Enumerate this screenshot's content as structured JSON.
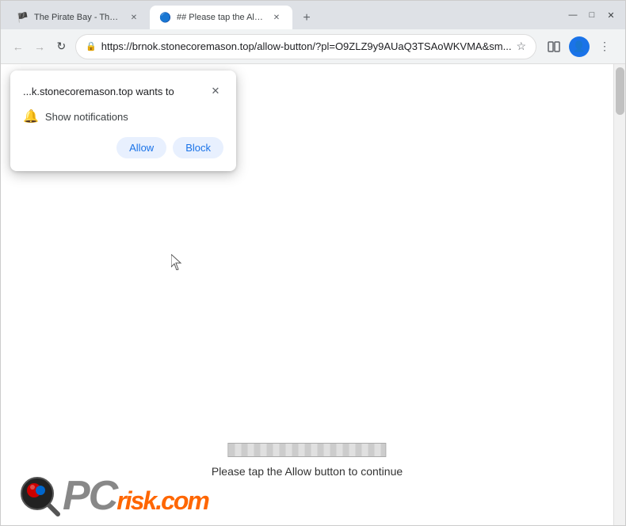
{
  "browser": {
    "tabs": [
      {
        "id": "tab1",
        "label": "The Pirate Bay - The galaxy's m...",
        "favicon": "🏴",
        "active": false
      },
      {
        "id": "tab2",
        "label": "## Please tap the Allow button...",
        "favicon": "🔵",
        "active": true
      }
    ],
    "window_controls": {
      "minimize": "—",
      "maximize": "□",
      "close": "✕"
    },
    "url": "https://brnok.stonecoremason.top/allow-button/?pl=O9ZLZ9y9AUaQ3TSAoWKVMA&sm...",
    "nav": {
      "back": "←",
      "forward": "→",
      "refresh": "↻"
    }
  },
  "permission_dialog": {
    "title": "...k.stonecoremason.top wants to",
    "close_label": "✕",
    "permission_text": "Show notifications",
    "allow_label": "Allow",
    "block_label": "Block"
  },
  "page": {
    "progress_text": "",
    "message": "Please tap the Allow button to continue"
  },
  "logo": {
    "pc_text": "PC",
    "risk_text": "risk.com"
  }
}
